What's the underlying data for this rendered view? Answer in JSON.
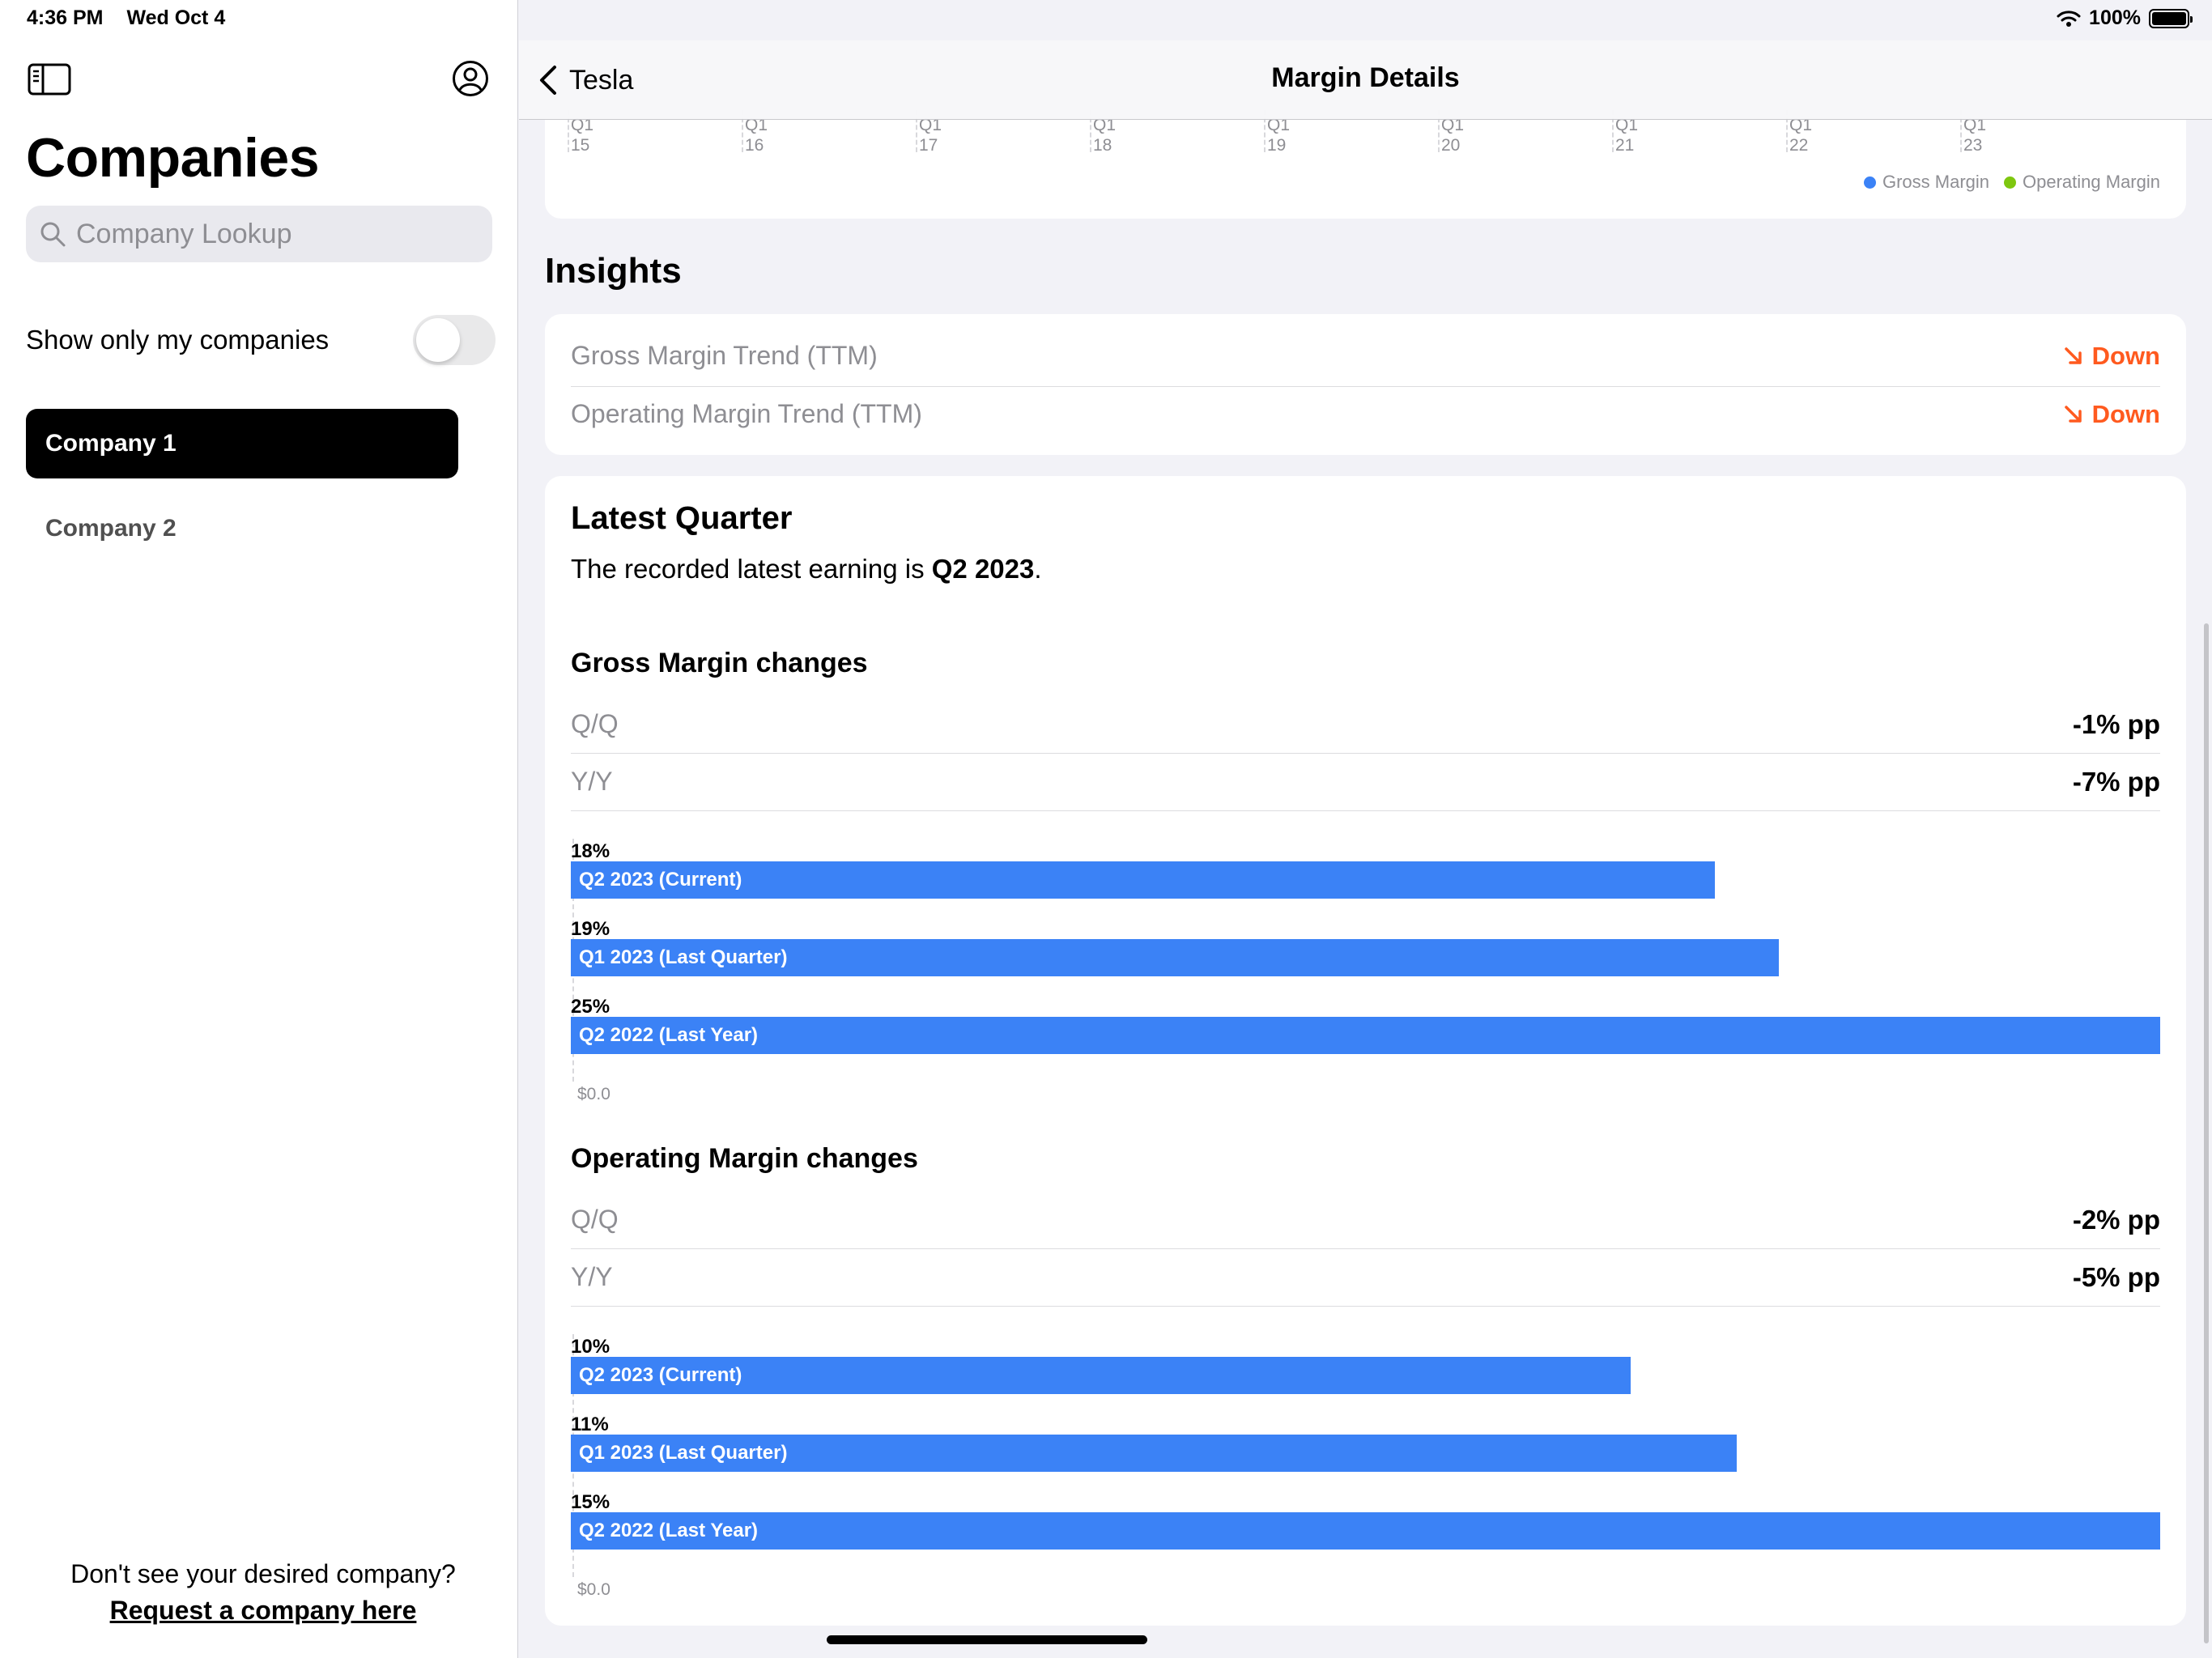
{
  "status_bar": {
    "time": "4:36 PM",
    "date": "Wed Oct 4",
    "battery": "100%"
  },
  "sidebar": {
    "title": "Companies",
    "search_placeholder": "Company Lookup",
    "toggle_label": "Show only my companies",
    "toggle_on": false,
    "companies": [
      {
        "label": "Company 1",
        "selected": true
      },
      {
        "label": "Company 2",
        "selected": false
      }
    ],
    "footer_text": "Don't see your desired company?",
    "footer_link": "Request a company here"
  },
  "navbar": {
    "back_label": "Tesla",
    "title": "Margin Details"
  },
  "top_chart": {
    "ticks": [
      {
        "q": "Q1",
        "y": "15"
      },
      {
        "q": "Q1",
        "y": "16"
      },
      {
        "q": "Q1",
        "y": "17"
      },
      {
        "q": "Q1",
        "y": "18"
      },
      {
        "q": "Q1",
        "y": "19"
      },
      {
        "q": "Q1",
        "y": "20"
      },
      {
        "q": "Q1",
        "y": "21"
      },
      {
        "q": "Q1",
        "y": "22"
      },
      {
        "q": "Q1",
        "y": "23"
      }
    ],
    "legend": [
      {
        "label": "Gross Margin",
        "color": "#3b82f6"
      },
      {
        "label": "Operating Margin",
        "color": "#7ec70f"
      }
    ]
  },
  "insights": {
    "title": "Insights",
    "rows": [
      {
        "label": "Gross Margin Trend (TTM)",
        "value": "Down"
      },
      {
        "label": "Operating Margin Trend (TTM)",
        "value": "Down"
      }
    ]
  },
  "latest_quarter": {
    "title": "Latest Quarter",
    "subtitle_prefix": "The recorded latest earning is ",
    "quarter": "Q2 2023",
    "subtitle_suffix": ".",
    "axis_zero": "$0.0",
    "groups": [
      {
        "title": "Gross Margin changes",
        "qq_label": "Q/Q",
        "qq_value": "-1% pp",
        "yy_label": "Y/Y",
        "yy_value": "-7% pp",
        "bars": [
          {
            "value_label": "18%",
            "label": "Q2 2023 (Current)",
            "value": 18
          },
          {
            "value_label": "19%",
            "label": "Q1 2023 (Last Quarter)",
            "value": 19
          },
          {
            "value_label": "25%",
            "label": "Q2 2022 (Last Year)",
            "value": 25
          }
        ]
      },
      {
        "title": "Operating Margin changes",
        "qq_label": "Q/Q",
        "qq_value": "-2% pp",
        "yy_label": "Y/Y",
        "yy_value": "-5% pp",
        "bars": [
          {
            "value_label": "10%",
            "label": "Q2 2023 (Current)",
            "value": 10
          },
          {
            "value_label": "11%",
            "label": "Q1 2023 (Last Quarter)",
            "value": 11
          },
          {
            "value_label": "15%",
            "label": "Q2 2022 (Last Year)",
            "value": 15
          }
        ]
      }
    ]
  },
  "colors": {
    "accent_bar": "#3b82f6",
    "trend_down": "#ff5a1f",
    "selected_company_bg": "#000000"
  }
}
